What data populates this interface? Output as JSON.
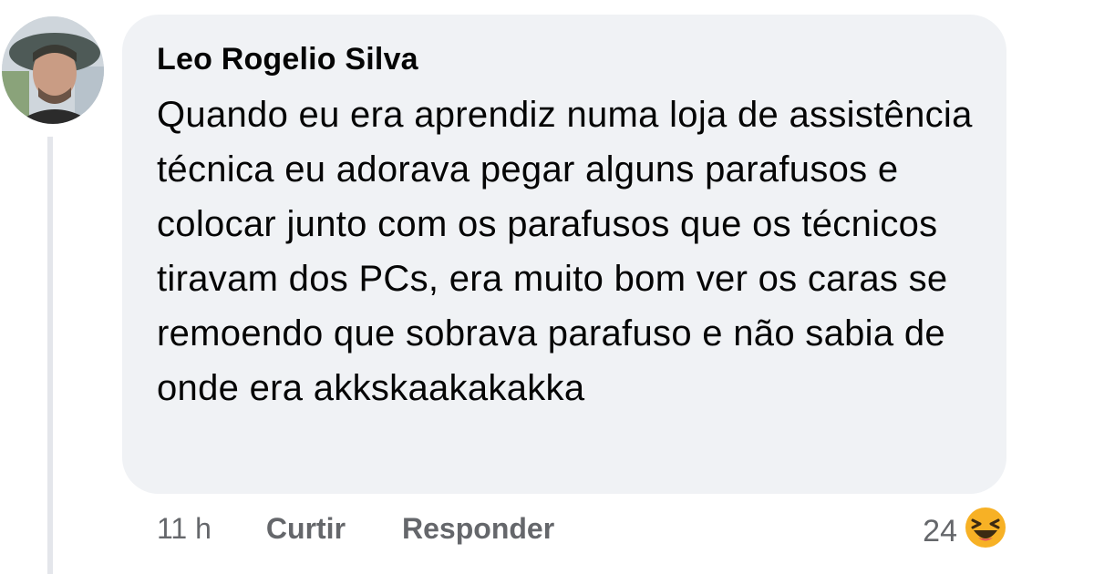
{
  "comment": {
    "author": "Leo Rogelio Silva",
    "text": "Quando eu era aprendiz numa loja de assistência técnica eu adorava pegar alguns parafusos e colocar junto com os parafusos que os técnicos tiravam dos PCs, era muito bom ver os caras se remoendo que sobrava parafuso e não sabia de onde era akkskaakakakka",
    "timestamp": "11 h",
    "like_label": "Curtir",
    "reply_label": "Responder",
    "reaction_count": "24",
    "reaction_icon": "laughing-emoji-icon"
  },
  "colors": {
    "bubble_bg": "#f0f2f5",
    "text": "#050505",
    "meta_text": "#65676b",
    "thread_line": "#e4e6eb",
    "emoji_yellow": "#f7b125"
  }
}
